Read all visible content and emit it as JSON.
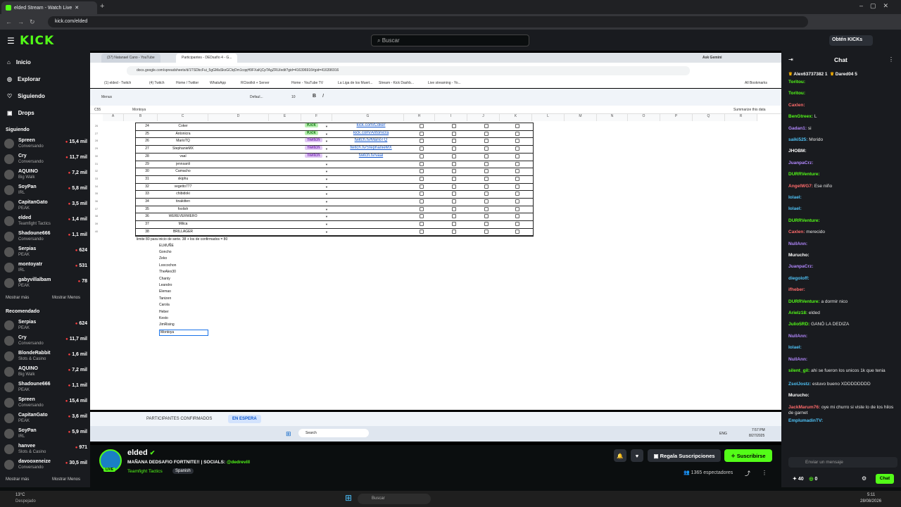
{
  "browser": {
    "tab_title": "elded Stream - Watch Live",
    "url": "kick.com/elded"
  },
  "kick": {
    "search_placeholder": "Buscar",
    "get_kicks": "Obtén KICKs"
  },
  "sidebar": {
    "nav": [
      {
        "label": "Inicio",
        "icon": "home-icon"
      },
      {
        "label": "Explorar",
        "icon": "compass-icon"
      },
      {
        "label": "Siguiendo",
        "icon": "heart-icon"
      },
      {
        "label": "Drops",
        "icon": "gift-icon"
      }
    ],
    "following_title": "Siguiendo",
    "following": [
      {
        "name": "Spreen",
        "cat": "Conversando",
        "viewers": "15,4 mil"
      },
      {
        "name": "Cry",
        "cat": "Conversando",
        "viewers": "11,7 mil"
      },
      {
        "name": "AQUINO",
        "cat": "Big Walk",
        "viewers": "7,2 mil"
      },
      {
        "name": "SoyPan",
        "cat": "IRL",
        "viewers": "5,8 mil"
      },
      {
        "name": "CapitanGato",
        "cat": "PEAK",
        "viewers": "3,5 mil"
      },
      {
        "name": "elded",
        "cat": "Teamfight Tactics",
        "viewers": "1,4 mil"
      },
      {
        "name": "Shadoune666",
        "cat": "Conversando",
        "viewers": "1,1 mil"
      },
      {
        "name": "Serpias",
        "cat": "PEAK",
        "viewers": "624"
      },
      {
        "name": "montoyatr",
        "cat": "IRL",
        "viewers": "531"
      },
      {
        "name": "gabyvillalbam",
        "cat": "PEAK",
        "viewers": "78"
      }
    ],
    "show_more": "Mostrar más",
    "show_less": "Mostrar Menos",
    "recommended_title": "Recomendado",
    "recommended": [
      {
        "name": "Serpias",
        "cat": "PEAK",
        "viewers": "624"
      },
      {
        "name": "Cry",
        "cat": "Conversando",
        "viewers": "11,7 mil"
      },
      {
        "name": "BlondeRabbit",
        "cat": "Slots & Casino",
        "viewers": "1,6 mil"
      },
      {
        "name": "AQUINO",
        "cat": "Big Walk",
        "viewers": "7,2 mil"
      },
      {
        "name": "Shadoune666",
        "cat": "PEAK",
        "viewers": "1,1 mil"
      },
      {
        "name": "Spreen",
        "cat": "Conversando",
        "viewers": "15,4 mil"
      },
      {
        "name": "CapitanGato",
        "cat": "PEAK",
        "viewers": "3,6 mil"
      },
      {
        "name": "SoyPan",
        "cat": "IRL",
        "viewers": "5,9 mil"
      },
      {
        "name": "hanvee",
        "cat": "Slots & Casino",
        "viewers": "971"
      },
      {
        "name": "davooxeneize",
        "cat": "Conversando",
        "viewers": "30,5 mil"
      }
    ]
  },
  "inner": {
    "tabs": [
      "(37) Natanael Cano - YouTube",
      "Participantes - DEDsafío 4 - G..."
    ],
    "ask_gemini": "Ask Gemini",
    "url": "docs.google.com/spreadsheets/d/1TSDbcFui_5gGMaSkxGClqOm1cqqH9FXaKjCpTAgZRU/edit?gid=416396916#gid=416396916",
    "bookmarks": [
      "(1) elded - Twitch",
      "(4) Twitch",
      "Home / Twitter",
      "WhatsApp",
      "RCtoolkit + Server",
      "Home - YouTube TV",
      "La Liga de los Muert...",
      "Stream - Kick Dashb...",
      "Live streaming - Yo...",
      "All Bookmarks"
    ],
    "menus": "Menus",
    "font": "Defaul...",
    "fontsize": "10",
    "cellref": "C55",
    "formula": "Montoya",
    "summarize": "Summarize this data",
    "columns": [
      "A",
      "B",
      "C",
      "D",
      "E",
      "F",
      "G",
      "H",
      "I",
      "J",
      "K",
      "L",
      "M",
      "N",
      "O",
      "P",
      "Q",
      "R"
    ],
    "rows": [
      {
        "n": "24",
        "name": "Coker",
        "plat": "Kick",
        "link": "kick.com/Coker"
      },
      {
        "n": "25",
        "name": "Antonicra",
        "plat": "Kick",
        "link": "kick.com/Antonicra"
      },
      {
        "n": "26",
        "name": "MarioTQ",
        "plat": "Twitch",
        "link": "twitch.tv/MarioTQ"
      },
      {
        "n": "27",
        "name": "StephanieMX",
        "plat": "Twitch",
        "link": "twitch.tv/StephanieMX"
      },
      {
        "n": "28",
        "name": "vaal",
        "plat": "Twitch",
        "link": "twitch.tv/vaal"
      },
      {
        "n": "29",
        "name": "jennsanli",
        "plat": "",
        "link": ""
      },
      {
        "n": "30",
        "name": "Camacho",
        "plat": "",
        "link": ""
      },
      {
        "n": "31",
        "name": "xkiphu",
        "plat": "",
        "link": ""
      },
      {
        "n": "32",
        "name": "vegetto777",
        "plat": "",
        "link": ""
      },
      {
        "n": "33",
        "name": "chibidoki",
        "plat": "",
        "link": ""
      },
      {
        "n": "34",
        "name": "tinakitten",
        "plat": "",
        "link": ""
      },
      {
        "n": "35",
        "name": "foolish",
        "plat": "",
        "link": ""
      },
      {
        "n": "36",
        "name": "WEREVERWERO",
        "plat": "",
        "link": ""
      },
      {
        "n": "37",
        "name": "Milica",
        "plat": "",
        "link": ""
      },
      {
        "n": "38",
        "name": "BRILLAGER",
        "plat": "",
        "link": ""
      }
    ],
    "note": "limite 80 para inicio de serie. 38 + los de confirmados = 80",
    "waitlist": [
      "ELMUÑE",
      "Goncho",
      "Zeko",
      "Loocochon",
      "TheAlex30",
      "Chanty",
      "Leandro",
      "Elemao",
      "Tanizen",
      "Carola",
      "Heber",
      "Kesto",
      "JimRising",
      "Montoya"
    ],
    "sheet_tabs": [
      "PARTICIPANTES CONFIRMADOS",
      "EN ESPERA"
    ],
    "taskbar_search": "Search",
    "time": "7:57 PM",
    "date": "8/27/2025",
    "lang": "ENG"
  },
  "stream": {
    "name": "elded",
    "title_prefix": "MAÑANA DEDSAFIO FORTNITE!! | SOCIALS:",
    "social": "@dedrevill",
    "category": "Teamfight Tactics",
    "language": "Spanish",
    "live": "LIVE",
    "gift": "Regala Suscripciones",
    "subscribe": "Suscribirse",
    "viewers": "1365 espectadores"
  },
  "chat": {
    "title": "Chat",
    "top": [
      {
        "u": "Alex63737382",
        "n": "1"
      },
      {
        "u": "Dared04",
        "n": "5"
      }
    ],
    "messages": [
      {
        "u": "Toritou:",
        "t": "",
        "c": "#53fc18"
      },
      {
        "u": "Toritou:",
        "t": "",
        "c": "#53fc18"
      },
      {
        "u": "Caxlen:",
        "t": "",
        "c": "#ff6b6b"
      },
      {
        "u": "BenGtreex:",
        "t": "L",
        "c": "#53fc18"
      },
      {
        "u": "Gadan1:",
        "t": "si",
        "c": "#b388ff"
      },
      {
        "u": "saiki525:",
        "t": "Morido",
        "c": "#4fc3f7"
      },
      {
        "u": "JHOBM:",
        "t": "",
        "c": "#fff"
      },
      {
        "u": "JuanpaCrz:",
        "t": "",
        "c": "#b388ff"
      },
      {
        "u": "DURRVenture:",
        "t": "",
        "c": "#53fc18"
      },
      {
        "u": "AngelWG7:",
        "t": "Ese niño",
        "c": "#ff6b6b"
      },
      {
        "u": "Iolael:",
        "t": "",
        "c": "#4fc3f7"
      },
      {
        "u": "Iolael:",
        "t": "",
        "c": "#4fc3f7"
      },
      {
        "u": "DURRVenture:",
        "t": "",
        "c": "#53fc18"
      },
      {
        "u": "Caxlen:",
        "t": "merecido",
        "c": "#ff6b6b"
      },
      {
        "u": "NullAnn:",
        "t": "",
        "c": "#b388ff"
      },
      {
        "u": "Murucho:",
        "t": "",
        "c": "#fff"
      },
      {
        "u": "JuanpaCrz:",
        "t": "",
        "c": "#b388ff"
      },
      {
        "u": "diegoloff:",
        "t": "",
        "c": "#4fc3f7"
      },
      {
        "u": "ifheber:",
        "t": "",
        "c": "#ff6b6b"
      },
      {
        "u": "DURRVenture:",
        "t": "a dormir nico",
        "c": "#53fc18"
      },
      {
        "u": "Arielz18:",
        "t": "elded",
        "c": "#53fc18"
      },
      {
        "u": "Julio5RD:",
        "t": "GANÓ LA DEDIZA",
        "c": "#53fc18"
      },
      {
        "u": "NullAnn:",
        "t": "",
        "c": "#b388ff"
      },
      {
        "u": "Iolael:",
        "t": "",
        "c": "#4fc3f7"
      },
      {
        "u": "NullAnn:",
        "t": "",
        "c": "#b388ff"
      },
      {
        "u": "silent_gil:",
        "t": "ahi se fueron los unicos 1k que tenia",
        "c": "#53fc18"
      },
      {
        "u": "ZsolJostz:",
        "t": "estuvo bueno XDDDDDDDD",
        "c": "#4fc3f7"
      },
      {
        "u": "Murucho:",
        "t": "",
        "c": "#fff"
      },
      {
        "u": "JackMarum76:",
        "t": "oye mi churro si viste lo de los hilos de garnet",
        "c": "#ff6b6b"
      },
      {
        "u": "EmplumadinTV:",
        "t": "",
        "c": "#4fc3f7"
      }
    ],
    "input_placeholder": "Enviar un mensaje",
    "count_a": "40",
    "count_b": "0",
    "send": "Chat"
  },
  "os": {
    "weather": "13°C",
    "weather_desc": "Despejado",
    "search": "Buscar",
    "time": "5:11",
    "date": "28/08/2026"
  }
}
